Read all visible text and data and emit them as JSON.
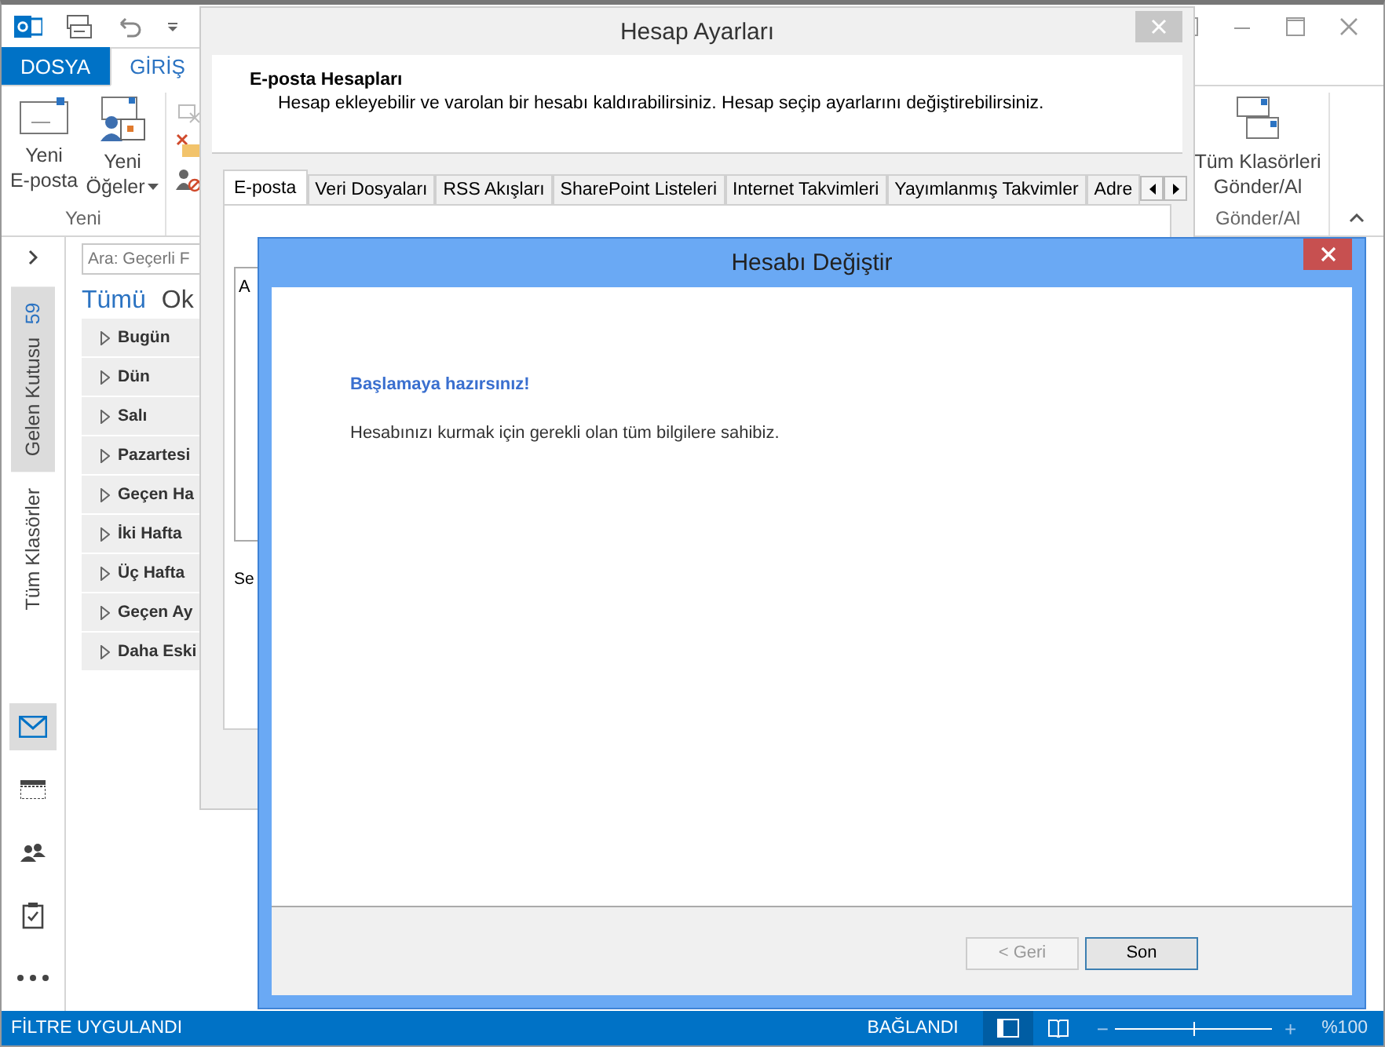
{
  "ribbon_tabs": [
    {
      "label": "DOSYA",
      "kind": "file",
      "selected": false
    },
    {
      "label": "GİRİŞ",
      "kind": "tab",
      "selected": true
    }
  ],
  "ribbon": {
    "new_group": {
      "label": "Yeni",
      "buttons": [
        {
          "lines": [
            "Yeni",
            "E-posta"
          ],
          "kind": "mail"
        },
        {
          "lines": [
            "Yeni",
            "Öğeler"
          ],
          "kind": "items",
          "dropdown": true
        }
      ]
    },
    "send_group": {
      "label": "Gönder/Al",
      "buttons": [
        {
          "lines": [
            "Tüm Klasörleri",
            "Gönder/Al"
          ],
          "kind": "sendall"
        }
      ]
    }
  },
  "folder_tabs": [
    {
      "label": "Gelen Kutusu",
      "count": "59",
      "selected": true
    },
    {
      "label": "Tüm Klasörler",
      "selected": false
    }
  ],
  "search": {
    "placeholder": "Ara: Geçerli F"
  },
  "filters": [
    {
      "label": "Tümü",
      "selected": true
    },
    {
      "label": "Ok",
      "selected": false
    }
  ],
  "groups": [
    "Bugün",
    "Dün",
    "Salı",
    "Pazartesi",
    "Geçen Ha",
    "İki Hafta",
    "Üç Hafta",
    "Geçen Ay",
    "Daha Eski"
  ],
  "modules": [
    {
      "kind": "mail",
      "selected": true
    },
    {
      "kind": "calendar",
      "selected": false
    },
    {
      "kind": "people",
      "selected": false
    },
    {
      "kind": "tasks",
      "selected": false
    },
    {
      "kind": "more",
      "selected": false
    }
  ],
  "status_bar": {
    "filter": "FİLTRE UYGULANDI",
    "connection": "BAĞLANDI",
    "views": [
      {
        "kind": "normal",
        "selected": true
      },
      {
        "kind": "reading",
        "selected": false
      }
    ],
    "zoom_out": "−",
    "zoom_in": "+",
    "level": 0.5,
    "zoom": "%100"
  },
  "account_settings": {
    "title": "Hesap Ayarları",
    "heading": "E-posta Hesapları",
    "description": "Hesap ekleyebilir ve varolan bir hesabı kaldırabilirsiniz. Hesap seçip ayarlarını değiştirebilirsiniz.",
    "tabs": [
      {
        "label": "E-posta",
        "selected": true
      },
      {
        "label": "Veri Dosyaları",
        "selected": false
      },
      {
        "label": "RSS Akışları",
        "selected": false
      },
      {
        "label": "SharePoint Listeleri",
        "selected": false
      },
      {
        "label": "Internet Takvimleri",
        "selected": false
      },
      {
        "label": "Yayımlanmış Takvimler",
        "selected": false
      },
      {
        "label": "Adre",
        "selected": false
      }
    ],
    "list_header": "A",
    "footer_text": "Se"
  },
  "change_account": {
    "title": "Hesabı Değiştir",
    "heading": "Başlamaya hazırsınız!",
    "message": "Hesabınızı kurmak için gerekli olan tüm bilgilere sahibiz.",
    "buttons": [
      {
        "label": "< Geri",
        "kind": "back",
        "disabled": true
      },
      {
        "label": "Son",
        "kind": "finish",
        "disabled": false
      }
    ]
  }
}
